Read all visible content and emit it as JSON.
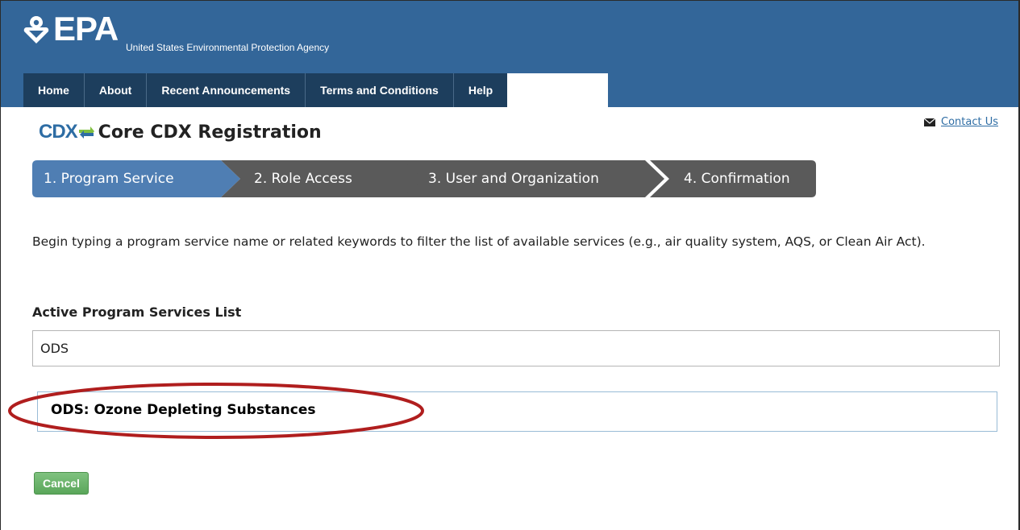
{
  "header": {
    "logo_text": "EPA",
    "agency_name": "United States Environmental Protection Agency"
  },
  "nav": {
    "items": [
      {
        "label": "Home"
      },
      {
        "label": "About"
      },
      {
        "label": "Recent Announcements"
      },
      {
        "label": "Terms and Conditions"
      },
      {
        "label": "Help"
      }
    ]
  },
  "app": {
    "logo_text": "CDX",
    "title": "Core CDX Registration",
    "contact_label": "Contact Us"
  },
  "steps": [
    {
      "label": "1. Program Service",
      "state": "active"
    },
    {
      "label": "2. Role Access",
      "state": "inactive"
    },
    {
      "label": "3. User and Organization",
      "state": "inactive"
    },
    {
      "label": "4. Confirmation",
      "state": "inactive"
    }
  ],
  "main": {
    "instructions": "Begin typing a program service name or related keywords to filter the list of available services (e.g., air quality system, AQS, or Clean Air Act).",
    "list_label": "Active Program Services List",
    "search_value": "ODS",
    "results": [
      {
        "label": "ODS: Ozone Depleting Substances"
      }
    ],
    "cancel_label": "Cancel"
  },
  "colors": {
    "header_bg": "#336699",
    "nav_bg": "#1d3e5d",
    "step_active": "#4f7eb3",
    "step_inactive": "#5a5a5a",
    "highlight": "#b01e1e",
    "cancel_bg": "#5aa65a"
  }
}
